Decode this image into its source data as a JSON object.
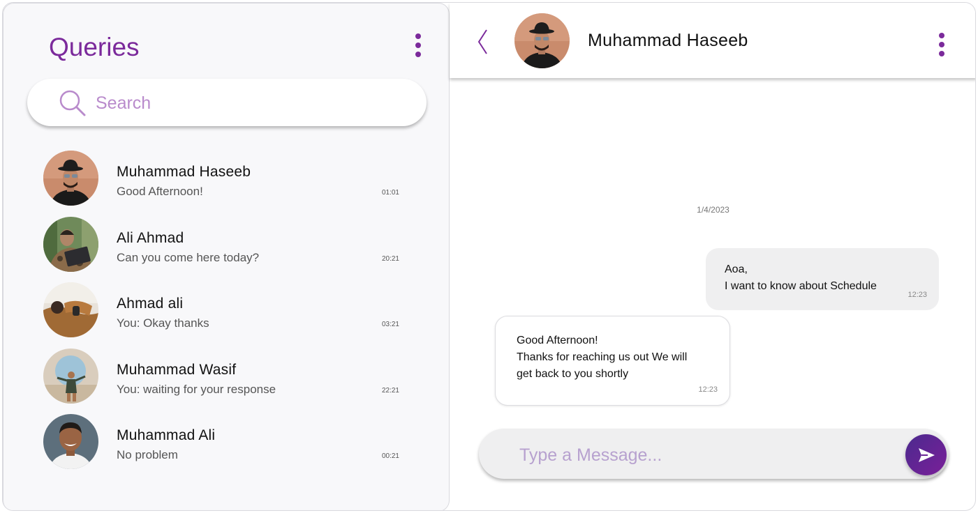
{
  "sidebar": {
    "title": "Queries",
    "search_placeholder": "Search",
    "contacts": [
      {
        "name": "Muhammad Haseeb",
        "last_message": "Good Afternoon!",
        "time": "01:01"
      },
      {
        "name": "Ali Ahmad",
        "last_message": "Can you come here today?",
        "time": "20:21"
      },
      {
        "name": "Ahmad ali",
        "last_message": "You: Okay thanks",
        "time": "03:21"
      },
      {
        "name": "Muhammad Wasif",
        "last_message": "You: waiting for your response",
        "time": "22:21"
      },
      {
        "name": "Muhammad Ali",
        "last_message": "No problem",
        "time": "00:21"
      }
    ]
  },
  "chat": {
    "contact_name": "Muhammad Haseeb",
    "date": "1/4/2023",
    "messages": [
      {
        "direction": "outgoing",
        "text": "Aoa,\nI want to know about Schedule",
        "time": "12:23"
      },
      {
        "direction": "incoming",
        "text": "Good Afternoon!\nThanks for reaching us out We will\nget back to you shortly",
        "time": "12:23"
      }
    ],
    "composer_placeholder": "Type a Message..."
  },
  "colors": {
    "accent": "#7b2a9b",
    "panel_bg": "#f8f8fa",
    "bubble_bg": "#efeff0",
    "placeholder": "#b98bcc"
  }
}
